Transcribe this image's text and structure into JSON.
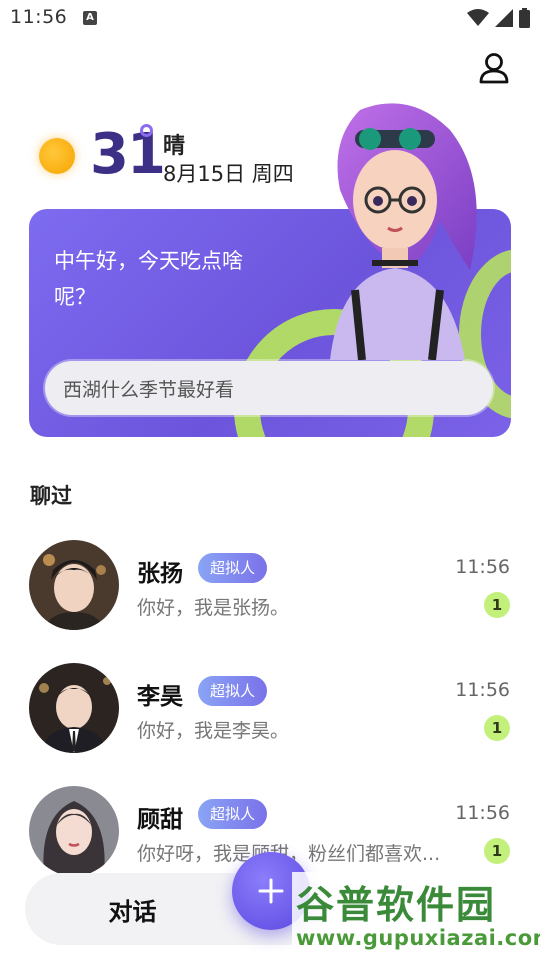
{
  "status_bar": {
    "time": "11:56",
    "notification_icon": "A"
  },
  "weather": {
    "temperature": "31",
    "condition": "晴",
    "date": "8月15日 周四"
  },
  "hero": {
    "greeting": "中午好，今天吃点啥呢？",
    "search_placeholder": "西湖什么季节最好看"
  },
  "section": {
    "title": "聊过"
  },
  "chats": [
    {
      "name": "张扬",
      "badge": "超拟人",
      "time": "11:56",
      "preview": "你好，我是张扬。",
      "unread": "1"
    },
    {
      "name": "李昊",
      "badge": "超拟人",
      "time": "11:56",
      "preview": "你好，我是李昊。",
      "unread": "1"
    },
    {
      "name": "顾甜",
      "badge": "超拟人",
      "time": "11:56",
      "preview": "你好呀，我是顾甜，粉丝们都喜欢...",
      "unread": "1"
    }
  ],
  "bottom_nav": {
    "tab_label": "对话",
    "fab_icon": "+"
  },
  "watermark": {
    "title": "谷普软件园",
    "url": "www.gupuxiazai.com"
  },
  "colors": {
    "accent": "#6c55dc",
    "badge_green": "#c2f07a",
    "sun": "#f7a400"
  }
}
